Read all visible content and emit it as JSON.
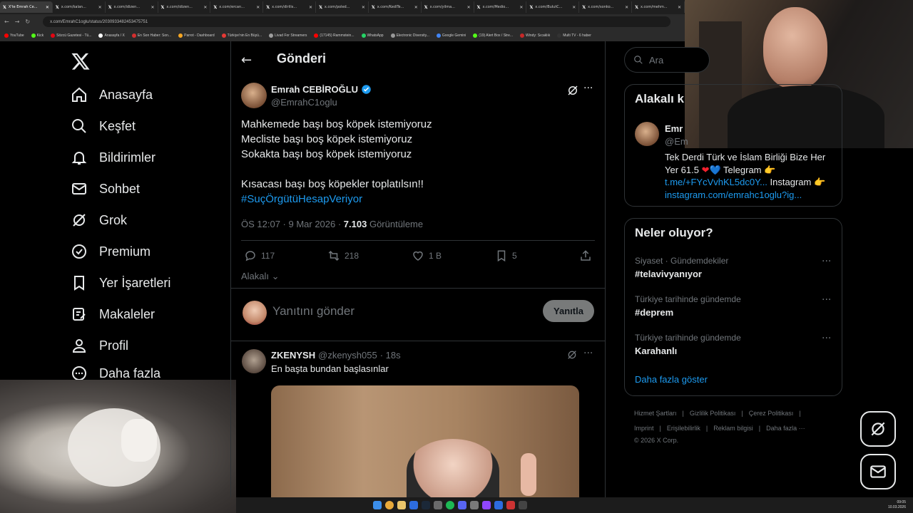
{
  "browser": {
    "tabs": [
      {
        "label": "X'te Emrah Ce...",
        "active": true
      },
      {
        "label": "x.com/kalan..."
      },
      {
        "label": "x.com/idizen..."
      },
      {
        "label": "x.com/idizen..."
      },
      {
        "label": "x.com/ercan..."
      },
      {
        "label": "x.com/dirilis..."
      },
      {
        "label": "x.com/poled..."
      },
      {
        "label": "x.com/KediTe..."
      },
      {
        "label": "x.com/yilma..."
      },
      {
        "label": "x.com/Medio..."
      },
      {
        "label": "x.com/BulutC..."
      },
      {
        "label": "x.com/sonko..."
      },
      {
        "label": "x.com/mehm..."
      }
    ],
    "url": "x.com/EmrahC1oglu/status/2030933482453475751",
    "bookmarks": [
      {
        "label": "YouTube",
        "color": "#ff0000"
      },
      {
        "label": "Kick",
        "color": "#53fc18"
      },
      {
        "label": "Sözcü Gazetesi - Tü...",
        "color": "#e30613"
      },
      {
        "label": "Anasayfa / X",
        "color": "#ffffff"
      },
      {
        "label": "En Son Haber: Son...",
        "color": "#d32f2f"
      },
      {
        "label": "Parrot - Dashboard",
        "color": "#f5a623"
      },
      {
        "label": "Türkiye'nin En Büyü...",
        "color": "#e53935"
      },
      {
        "label": "Livad For Streamers",
        "color": "#9e9e9e"
      },
      {
        "label": "(17145) Rammstein...",
        "color": "#ff0000"
      },
      {
        "label": "WhatsApp",
        "color": "#25d366"
      },
      {
        "label": "Electronic Diversity...",
        "color": "#999999"
      },
      {
        "label": "Google Gemini",
        "color": "#4285f4"
      },
      {
        "label": "(19) Alert Box / Stre...",
        "color": "#53fc18"
      },
      {
        "label": "Windy: Sıcaklık",
        "color": "#c62828"
      },
      {
        "label": "Multi TV - 6 haber",
        "color": "#333333"
      }
    ]
  },
  "sidebar": {
    "items": [
      {
        "label": "Anasayfa",
        "icon": "home-icon"
      },
      {
        "label": "Keşfet",
        "icon": "search-icon"
      },
      {
        "label": "Bildirimler",
        "icon": "bell-icon"
      },
      {
        "label": "Sohbet",
        "icon": "mail-icon"
      },
      {
        "label": "Grok",
        "icon": "grok-icon"
      },
      {
        "label": "Premium",
        "icon": "verified-icon"
      },
      {
        "label": "Yer İşaretleri",
        "icon": "bookmark-icon"
      },
      {
        "label": "Makaleler",
        "icon": "article-icon"
      },
      {
        "label": "Profil",
        "icon": "person-icon"
      },
      {
        "label": "Daha fazla",
        "icon": "more-icon"
      }
    ]
  },
  "post": {
    "header_title": "Gönderi",
    "author_name": "Emrah CEBİROĞLU",
    "author_handle": "@EmrahC1oglu",
    "lines": [
      "Mahkemede başı boş köpek istemiyoruz",
      "Mecliste başı boş köpek istemiyoruz",
      "Sokakta başı boş köpek istemiyoruz",
      "",
      "Kısacası başı boş köpekler toplatılsın!!"
    ],
    "hashtag": "#SuçÖrgütüHesapVeriyor",
    "time": "ÖS 12:07 · 9 Mar 2026 · ",
    "views_count": "7.103",
    "views_label": " Görüntüleme",
    "replies": "117",
    "reposts": "218",
    "likes": "1 B",
    "bookmarks": "5",
    "relevant_label": "Alakalı",
    "reply_placeholder": "Yanıtını gönder",
    "reply_button": "Yanıtla"
  },
  "reply": {
    "author_name": "ZKENYSH",
    "author_handle": "@zkenysh055",
    "time": "· 18s",
    "text": "En başta bundan başlasınlar"
  },
  "right": {
    "search_placeholder": "Ara",
    "related_title": "Alakalı k",
    "related_name": "Emr",
    "related_handle": "@Em",
    "bio_line1": "Tek Derdi Türk ve İslam Birliği Bize Her",
    "bio_line2_a": "Yer 61.5 ",
    "bio_line2_b": " Telegram ",
    "bio_link1": "t.me/+FYcVvhKL5dc0Y...",
    "bio_instagram": " Instagram ",
    "bio_link2": "instagram.com/emrahc1oglu?ig...",
    "trends_title": "Neler oluyor?",
    "trends": [
      {
        "sub": "Siyaset · Gündemdekiler",
        "title": "#telavivyanıyor"
      },
      {
        "sub": "Türkiye tarihinde gündemde",
        "title": "#deprem"
      },
      {
        "sub": "Türkiye tarihinde gündemde",
        "title": "Karahanlı"
      }
    ],
    "show_more": "Daha fazla göster",
    "footer_row1": [
      "Hizmet Şartları",
      "Gizlilik Politikası",
      "Çerez Politikası"
    ],
    "footer_row2": [
      "Imprint",
      "Erişilebilirlik",
      "Reklam bilgisi",
      "Daha fazla ···"
    ],
    "copyright": "© 2026 X Corp."
  },
  "taskbar": {
    "time": "09:05",
    "date": "10.03.2026"
  },
  "colors": {
    "accent": "#1d9bf0",
    "background": "#000000",
    "text": "#e7e9ea",
    "secondary_text": "#71767b",
    "border": "#2f3336"
  }
}
